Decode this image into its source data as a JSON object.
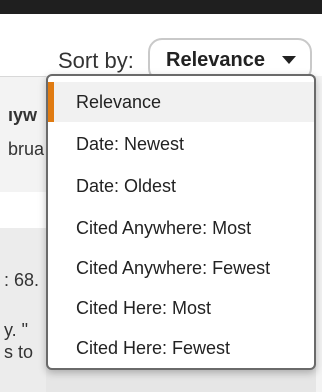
{
  "sort": {
    "label": "Sort by:",
    "selected": "Relevance",
    "options": [
      "Relevance",
      "Date: Newest",
      "Date: Oldest",
      "Cited Anywhere: Most",
      "Cited Anywhere: Fewest",
      "Cited Here: Most",
      "Cited Here: Fewest"
    ]
  },
  "background_fragments": {
    "line1": "ıyw",
    "line2": "brua",
    "line3": ": 68.",
    "line4": "y. \"",
    "line5": "s to"
  },
  "colors": {
    "accent": "#e07b12",
    "selected_bg": "#f1f1f1",
    "dropdown_border": "#6a6a6a"
  }
}
